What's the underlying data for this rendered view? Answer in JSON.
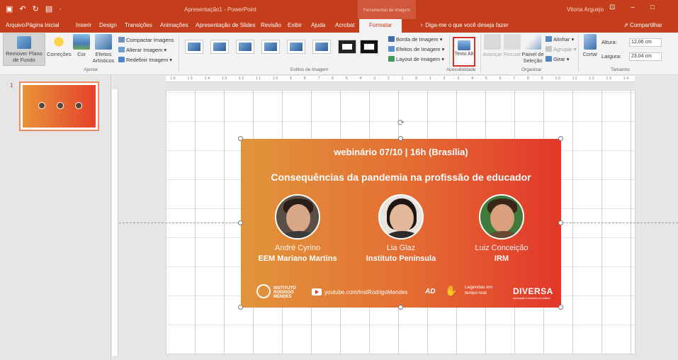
{
  "titlebar": {
    "title": "Apresentação1 - PowerPoint",
    "context_tab": "Ferramentas de Imagem",
    "user": "Vitoria Arguejo",
    "qat": [
      "save",
      "undo",
      "redo",
      "slideshow"
    ]
  },
  "tabs": [
    "Arquivo",
    "Página Inicial",
    "Inserir",
    "Design",
    "Transições",
    "Animações",
    "Apresentação de Slides",
    "Revisão",
    "Exibir",
    "Ajuda",
    "Acrobat",
    "Formatar"
  ],
  "tellme": "Diga-me o que você deseja fazer",
  "share": "Compartilhar",
  "ribbon": {
    "ajustar": {
      "label": "Ajustar",
      "remove_bg": "Remover Plano de Fundo",
      "corrections": "Correções",
      "color": "Cor",
      "effects": "Efeitos Artísticos",
      "compress": "Compactar Imagens",
      "change": "Alterar Imagem",
      "reset": "Redefinir Imagem"
    },
    "estilos": {
      "label": "Estilos de Imagem",
      "border": "Borda de Imagem",
      "effects": "Efeitos de Imagem",
      "layout": "Layout de Imagem"
    },
    "acessibilidade": {
      "label": "Acessibilidade",
      "alt_text": "Texto Alt"
    },
    "organizar": {
      "label": "Organizar",
      "forward": "Avançar",
      "backward": "Recuar",
      "selection_pane": "Painel de Seleção",
      "align": "Alinhar",
      "group": "Agrupar",
      "rotate": "Girar"
    },
    "tamanho": {
      "label": "Tamanho",
      "crop": "Cortar",
      "height_label": "Altura:",
      "height_value": "12,06 cm",
      "width_label": "Largura:",
      "width_value": "23,04 cm"
    }
  },
  "ruler_text": "· 16 · · 15 · · 14 · · 13 · · 12 · · 11 · · 10 · · 9 · · 8 · · 7 · · 6 · · 5 · · 4 · · 3 · · 2 · · 1 · · 0 · · 1 · · 2 · · 3 · · 4 · · 5 · · 6 · · 7 · · 8 · · 9 · · 10 · · 11 · · 12 · · 13 · · 14 · · 15 · · 16 ·",
  "slide_number": "1",
  "picture": {
    "title": "webinário 07/10 | 16h (Brasília)",
    "subtitle": "Consequências da pandemia na profissão de educador",
    "people": [
      {
        "name": "André Cyrino",
        "org": "EEM Mariano Martins"
      },
      {
        "name": "Lia Glaz",
        "org": "Instituto Península"
      },
      {
        "name": "Luiz Conceição",
        "org": "IRM"
      }
    ],
    "logo_irm": "INSTITUTO RODRIGO MENDES",
    "youtube": "youtube.com/InstRodrigoMendes",
    "ad": "AD",
    "captions": "Legendas em tempo real",
    "diversa": "DIVERSA",
    "diversa_sub": "educação inclusiva na prática"
  },
  "colors": {
    "accent": "#c43e1c",
    "pic_left": "#e1953b",
    "pic_right": "#e2362a"
  }
}
